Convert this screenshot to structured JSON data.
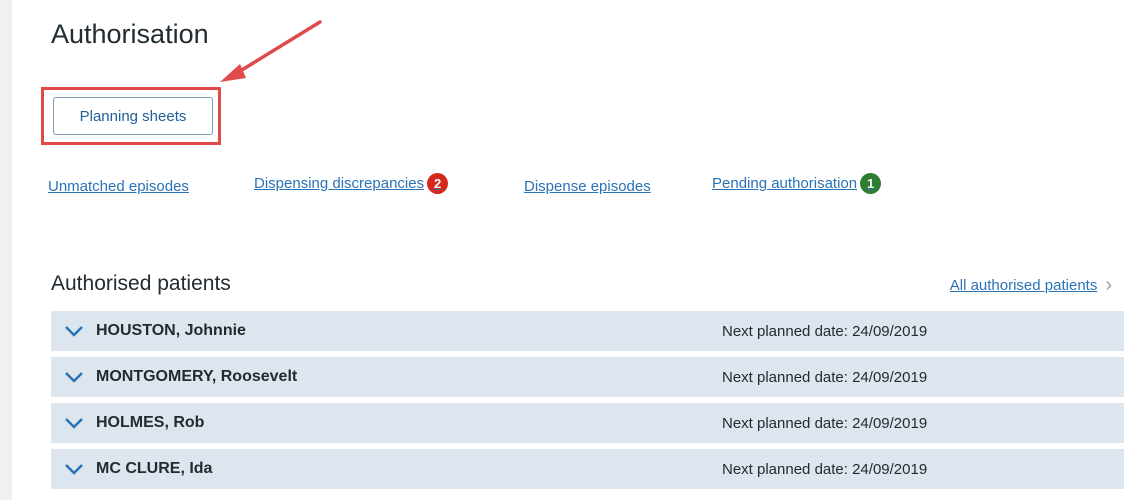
{
  "page": {
    "title": "Authorisation",
    "planning_button": "Planning sheets"
  },
  "nav": {
    "links": [
      {
        "label": "Unmatched episodes"
      },
      {
        "label": "Dispensing discrepancies",
        "badge": "2",
        "badge_color": "#d5281b"
      },
      {
        "label": "Dispense episodes"
      },
      {
        "label": "Pending authorisation",
        "badge": "1",
        "badge_color": "#2f7d32"
      }
    ]
  },
  "authorised": {
    "title": "Authorised patients",
    "all_link": "All authorised patients",
    "patients": [
      {
        "name": "HOUSTON, Johnnie",
        "next": "Next planned date: 24/09/2019"
      },
      {
        "name": "MONTGOMERY, Roosevelt",
        "next": "Next planned date: 24/09/2019"
      },
      {
        "name": "HOLMES, Rob",
        "next": "Next planned date: 24/09/2019"
      },
      {
        "name": "MC CLURE, Ida",
        "next": "Next planned date: 24/09/2019"
      }
    ]
  },
  "colors": {
    "link": "#2a73b6",
    "row_bg": "#dde6ee",
    "annotation": "#e04a4a"
  },
  "icons": {
    "row_toggle": "chevron-down-icon",
    "all_link": "chevron-right-icon",
    "annotation": "red-arrow-icon"
  }
}
